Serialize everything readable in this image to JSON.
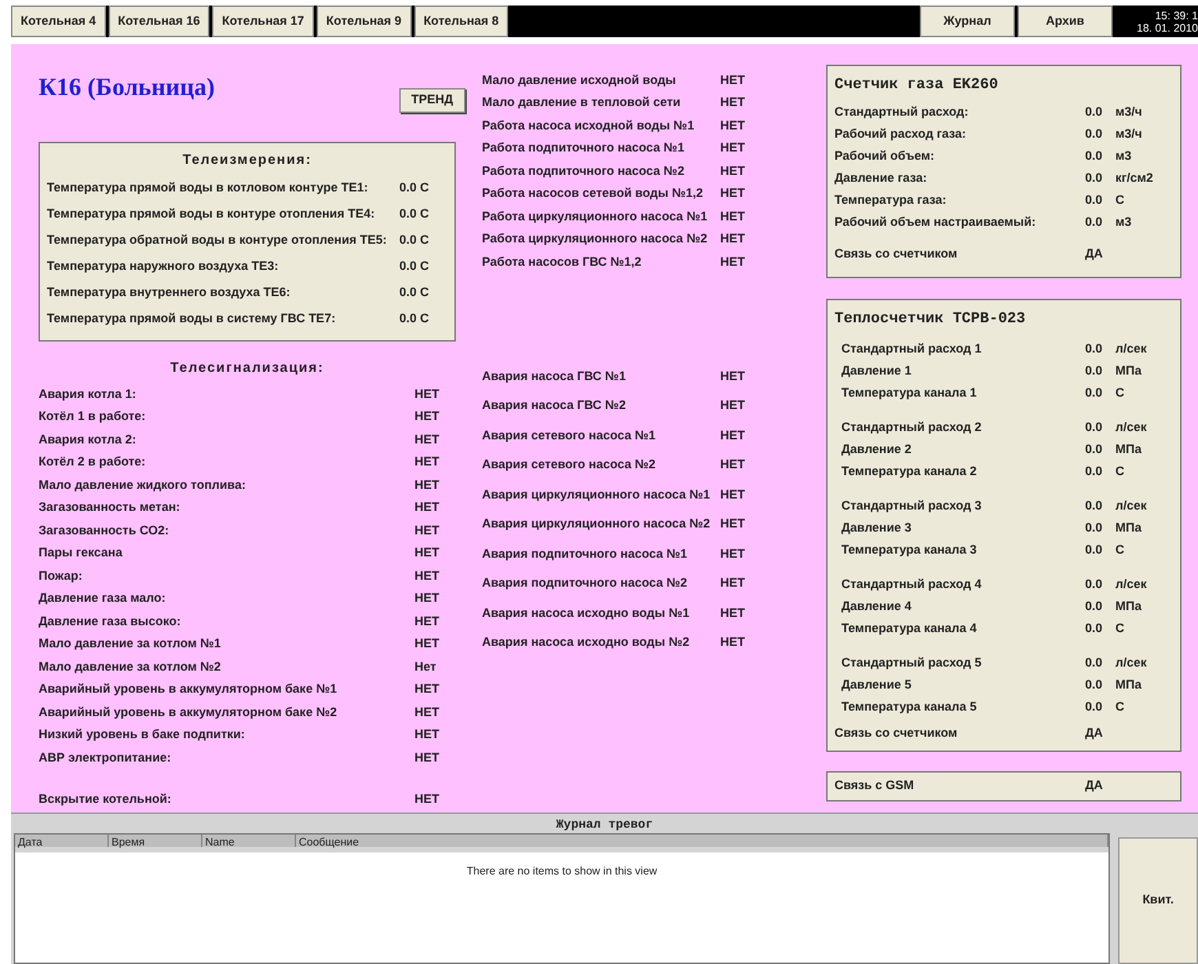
{
  "tabs": [
    {
      "label": "Котельная 4"
    },
    {
      "label": "Котельная 16"
    },
    {
      "label": "Котельная 17"
    },
    {
      "label": "Котельная 9"
    },
    {
      "label": "Котельная 8"
    }
  ],
  "toolbar_buttons": [
    "Журнал",
    "Архив"
  ],
  "clock": {
    "time": "15: 39: 1",
    "date": "18. 01. 2010"
  },
  "title": "К16 (Больница)",
  "trend_button": "ТРЕНД",
  "telemetry": {
    "title": "Телеизмерения:",
    "rows": [
      {
        "label": "Температура прямой воды в котловом контуре ТЕ1:",
        "value": "0.0 С"
      },
      {
        "label": "Температура прямой воды в контуре отопления ТЕ4:",
        "value": "0.0 С"
      },
      {
        "label": "Температура обратной воды в контуре отопления ТЕ5:",
        "value": "0.0 С"
      },
      {
        "label": "Температура наружного воздуха ТЕ3:",
        "value": "0.0 С"
      },
      {
        "label": "Температура внутреннего воздуха ТЕ6:",
        "value": "0.0 С"
      },
      {
        "label": "Температура прямой воды в систему ГВС ТЕ7:",
        "value": "0.0 С"
      }
    ]
  },
  "telesignals": {
    "title": "Телесигнализация:",
    "rows": [
      {
        "label": "Авария котла 1:",
        "value": "НЕТ"
      },
      {
        "label": "Котёл 1 в работе:",
        "value": "НЕТ"
      },
      {
        "label": "Авария котла 2:",
        "value": "НЕТ"
      },
      {
        "label": "Котёл 2 в работе:",
        "value": "НЕТ"
      },
      {
        "label": "Мало давление жидкого топлива:",
        "value": "НЕТ"
      },
      {
        "label": "Загазованность метан:",
        "value": "НЕТ"
      },
      {
        "label": "Загазованность СО2:",
        "value": "НЕТ"
      },
      {
        "label": "Пары гексана",
        "value": "НЕТ"
      },
      {
        "label": "Пожар:",
        "value": "НЕТ"
      },
      {
        "label": "Давление газа мало:",
        "value": "НЕТ"
      },
      {
        "label": "Давление газа высоко:",
        "value": "НЕТ"
      },
      {
        "label": "Мало давление за котлом №1",
        "value": "НЕТ"
      },
      {
        "label": "Мало давление за котлом №2",
        "value": "Нет"
      },
      {
        "label": "Аварийный уровень в аккумуляторном баке №1",
        "value": "НЕТ"
      },
      {
        "label": "Аварийный уровень в аккумуляторном баке №2",
        "value": "НЕТ"
      },
      {
        "label": "Низкий уровень в баке подпитки:",
        "value": "НЕТ"
      },
      {
        "label": "АВР электропитание:",
        "value": "НЕТ"
      },
      {
        "label": "Вскрытие котельной:",
        "value": "НЕТ"
      }
    ]
  },
  "pump_status": [
    {
      "label": "Мало давление исходной воды",
      "value": "НЕТ"
    },
    {
      "label": "Мало давление в тепловой сети",
      "value": "НЕТ"
    },
    {
      "label": "Работа насоса исходной воды №1",
      "value": "НЕТ"
    },
    {
      "label": "Работа подпиточного насоса №1",
      "value": "НЕТ"
    },
    {
      "label": "Работа подпиточного насоса №2",
      "value": "НЕТ"
    },
    {
      "label": "Работа насосов сетевой воды №1,2",
      "value": "НЕТ"
    },
    {
      "label": "Работа циркуляционного насоса №1",
      "value": "НЕТ"
    },
    {
      "label": "Работа циркуляционного насоса №2",
      "value": "НЕТ"
    },
    {
      "label": "Работа насосов ГВС №1,2",
      "value": "НЕТ"
    }
  ],
  "pump_alarms": [
    {
      "label": "Авария насоса ГВС №1",
      "value": "НЕТ"
    },
    {
      "label": "Авария насоса ГВС №2",
      "value": "НЕТ"
    },
    {
      "label": "Авария сетевого насоса  №1",
      "value": "НЕТ"
    },
    {
      "label": "Авария сетевого насоса  №2",
      "value": "НЕТ"
    },
    {
      "label": "Авария циркуляционного насоса  №1",
      "value": "НЕТ"
    },
    {
      "label": "Авария циркуляционного насоса  №2",
      "value": "НЕТ"
    },
    {
      "label": "Авария подпиточного насоса  №1",
      "value": "НЕТ"
    },
    {
      "label": "Авария подпиточного насоса  №2",
      "value": "НЕТ"
    },
    {
      "label": "Авария насоса исходно воды №1",
      "value": "НЕТ"
    },
    {
      "label": "Авария насоса исходно воды №2",
      "value": "НЕТ"
    }
  ],
  "gas_meter": {
    "title": "Счетчик газа EK260",
    "rows": [
      {
        "label": "Стандартный расход:",
        "value": "0.0",
        "unit": "м3/ч"
      },
      {
        "label": "Рабочий расход газа:",
        "value": "0.0",
        "unit": "м3/ч"
      },
      {
        "label": "Рабочий объем:",
        "value": "0.0",
        "unit": "м3"
      },
      {
        "label": "Давление газа:",
        "value": "0.0",
        "unit": "кг/см2"
      },
      {
        "label": "Температура газа:",
        "value": "0.0",
        "unit": "С"
      },
      {
        "label": "Рабочий объем настраиваемый:",
        "value": "0.0",
        "unit": "м3"
      }
    ],
    "link": {
      "label": "Связь со счетчиком",
      "value": "ДА"
    }
  },
  "heat_meter": {
    "title": "Теплосчетчик TCPB-023",
    "groups": [
      [
        {
          "label": "Стандартный расход 1",
          "value": "0.0",
          "unit": "л/сек"
        },
        {
          "label": "Давление  1",
          "value": "0.0",
          "unit": "МПа"
        },
        {
          "label": "Температура канала 1",
          "value": "0.0",
          "unit": "С"
        }
      ],
      [
        {
          "label": "Стандартный расход 2",
          "value": "0.0",
          "unit": "л/сек"
        },
        {
          "label": "Давление 2",
          "value": "0.0",
          "unit": "МПа"
        },
        {
          "label": "Температура канала 2",
          "value": "0.0",
          "unit": "С"
        }
      ],
      [
        {
          "label": "Стандартный расход 3",
          "value": "0.0",
          "unit": "л/сек"
        },
        {
          "label": "Давление 3",
          "value": "0.0",
          "unit": "МПа"
        },
        {
          "label": "Температура канала 3",
          "value": "0.0",
          "unit": "С"
        }
      ],
      [
        {
          "label": "Стандартный расход 4",
          "value": "0.0",
          "unit": "л/сек"
        },
        {
          "label": "Давление 4",
          "value": "0.0",
          "unit": "МПа"
        },
        {
          "label": "Температура канала 4",
          "value": "0.0",
          "unit": "С"
        }
      ],
      [
        {
          "label": "Стандартный расход 5",
          "value": "0.0",
          "unit": "л/сек"
        },
        {
          "label": "Давление 5",
          "value": "0.0",
          "unit": "МПа"
        },
        {
          "label": "Температура канала 5",
          "value": "0.0",
          "unit": "С"
        }
      ]
    ],
    "link": {
      "label": "Связь со счетчиком",
      "value": "ДА"
    }
  },
  "gsm": {
    "label": "Связь с GSM",
    "value": "ДА"
  },
  "alarm_log": {
    "title": "Журнал тревог",
    "columns": [
      "Дата",
      "Время",
      "Name",
      "Сообщение"
    ],
    "empty_text": "There are no items to show in this view"
  },
  "ack_button": "Квит."
}
